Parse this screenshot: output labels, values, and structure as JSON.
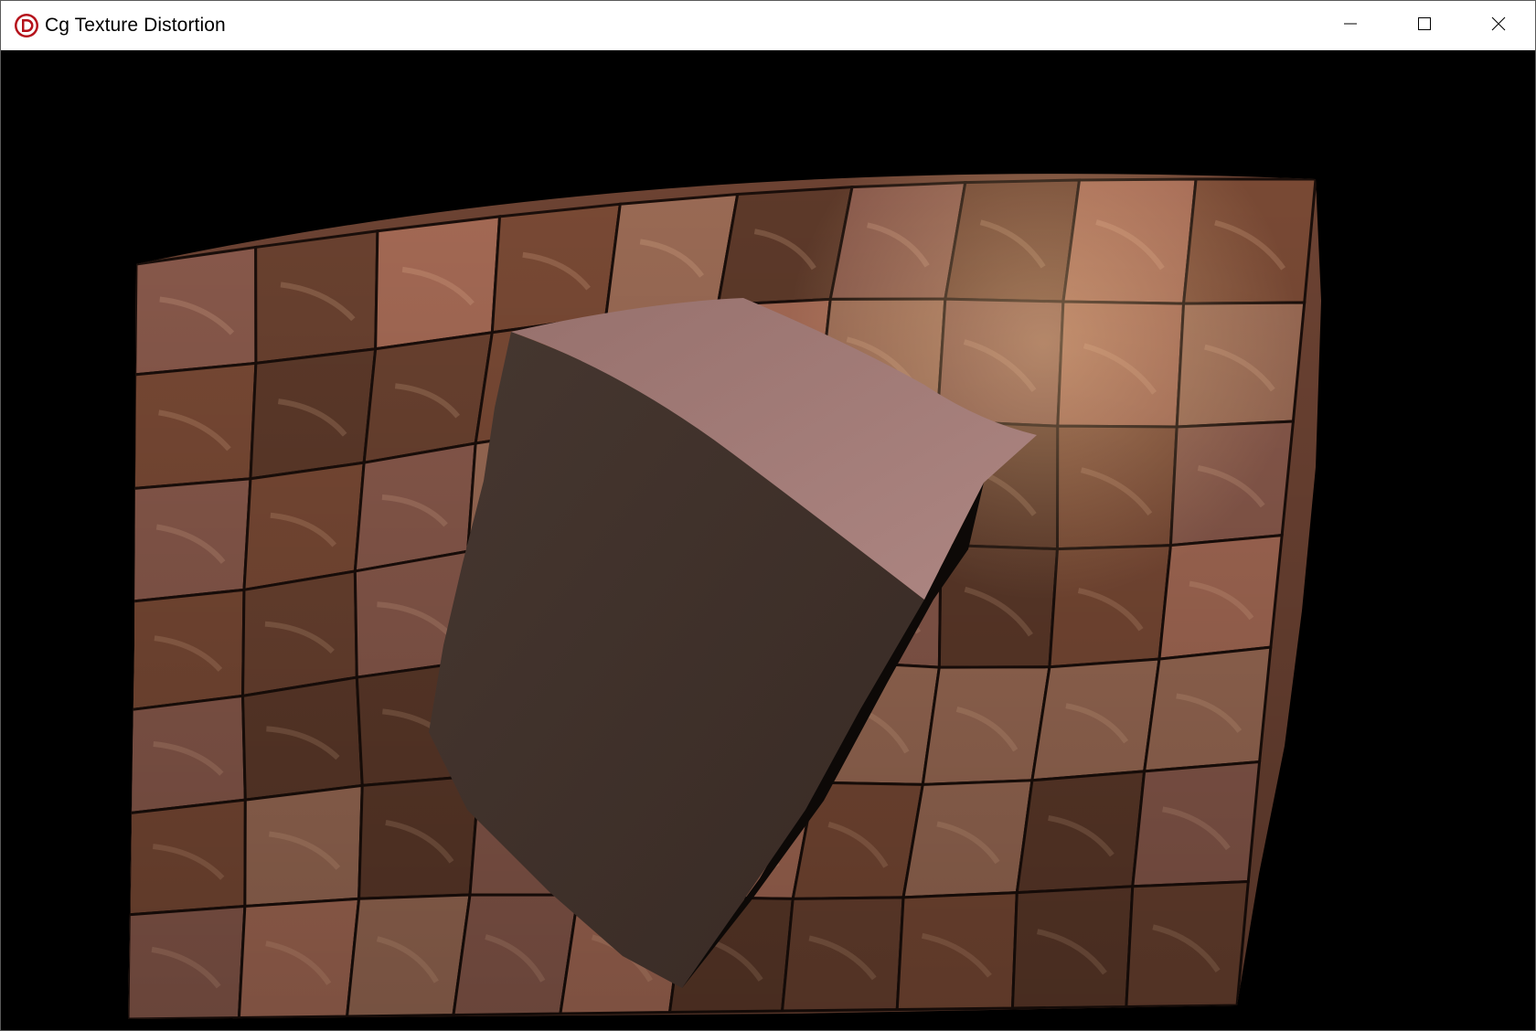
{
  "window": {
    "title": "Cg Texture Distortion",
    "app_icon": "demo-d-logo-icon"
  },
  "controls": {
    "minimize_icon": "minimize-icon",
    "maximize_icon": "maximize-icon",
    "close_icon": "close-icon"
  },
  "scene": {
    "background": "#000000",
    "floor_tile_colors": [
      "#8a5a4c",
      "#6b4230",
      "#a56a55",
      "#7a4a35",
      "#9b6b55",
      "#5e3a2a"
    ],
    "grout_color": "#1a0e0a",
    "cube_top_color": "#a57c78",
    "cube_front_color": "#3e3029"
  }
}
